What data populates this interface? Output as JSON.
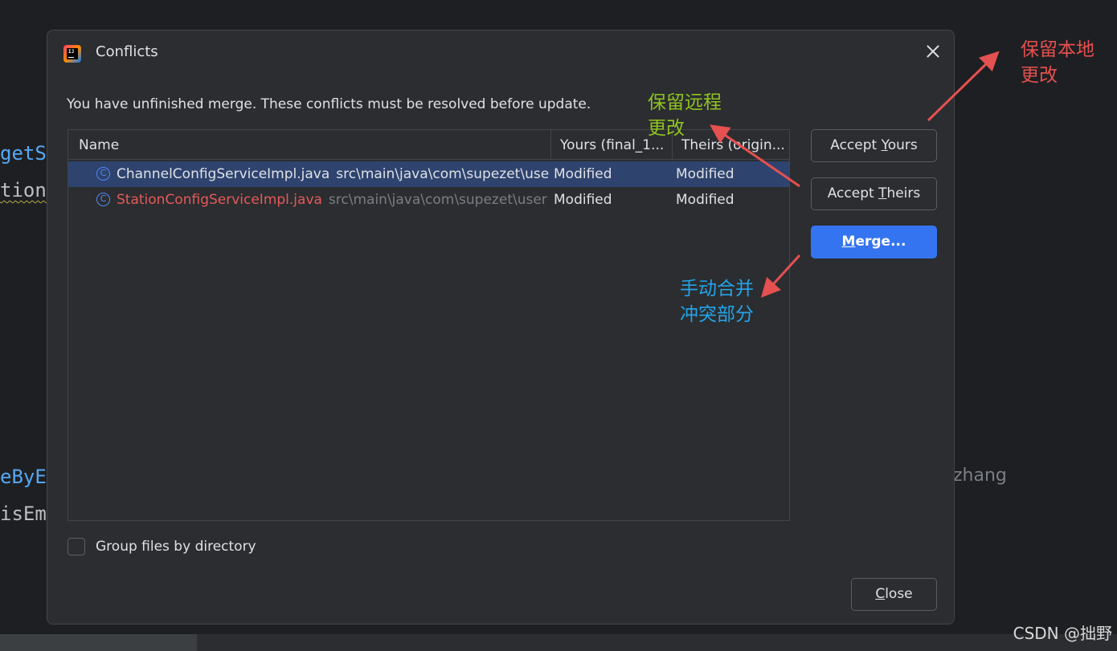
{
  "background": {
    "code_lines": [
      {
        "text": "getS"
      },
      {
        "text": "tion"
      },
      {
        "text": "eByE"
      },
      {
        "text": "isEm"
      }
    ],
    "author": "zhang"
  },
  "dialog": {
    "title": "Conflicts",
    "message": "You have unfinished merge. These conflicts must be resolved before update.",
    "columns": {
      "name": "Name",
      "yours": "Yours (final_1...",
      "theirs": "Theirs (origin..."
    },
    "rows": [
      {
        "file": "ChannelConfigServiceImpl.java",
        "path": "src\\main\\java\\com\\supezet\\user",
        "yours": "Modified",
        "theirs": "Modified",
        "selected": true
      },
      {
        "file": "StationConfigServiceImpl.java",
        "path": "src\\main\\java\\com\\supezet\\user",
        "yours": "Modified",
        "theirs": "Modified",
        "selected": false
      }
    ],
    "buttons": {
      "accept_yours_pre": "Accept ",
      "accept_yours_mn": "Y",
      "accept_yours_post": "ours",
      "accept_theirs_pre": "Accept ",
      "accept_theirs_mn": "T",
      "accept_theirs_post": "heirs",
      "merge_mn": "M",
      "merge_post": "erge...",
      "close_mn": "C",
      "close_post": "lose"
    },
    "group_by_directory": {
      "label": "Group files by directory",
      "checked": false
    }
  },
  "annotations": {
    "keep_local_1": "保留本地",
    "keep_local_2": "更改",
    "keep_remote_1": "保留远程",
    "keep_remote_2": "更改",
    "manual_merge_1": "手动合并",
    "manual_merge_2": "冲突部分"
  },
  "watermark": "CSDN @拙野",
  "colors": {
    "accent": "#3574f0",
    "selection": "#2e436e",
    "conflict_red": "#e55a5a",
    "annotation_red": "#e55050",
    "annotation_green": "#8fc31f",
    "annotation_blue": "#25a3e8"
  }
}
